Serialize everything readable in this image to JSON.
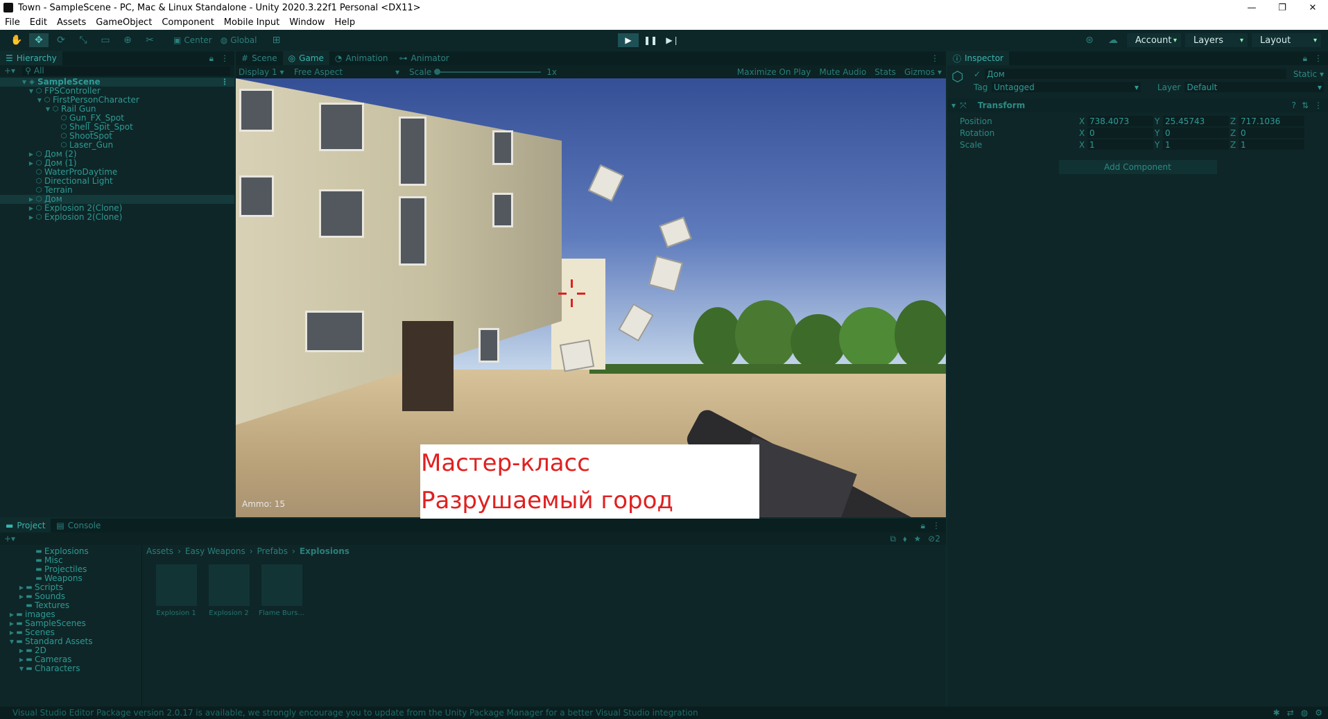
{
  "window": {
    "title": "Town - SampleScene - PC, Mac & Linux Standalone - Unity 2020.3.22f1 Personal <DX11>",
    "controls": [
      "—",
      "❐",
      "✕"
    ]
  },
  "menu": [
    "File",
    "Edit",
    "Assets",
    "GameObject",
    "Component",
    "Mobile Input",
    "Window",
    "Help"
  ],
  "toolbar": {
    "pivot": "Center",
    "space": "Global",
    "account": "Account",
    "layers": "Layers",
    "layout": "Layout"
  },
  "hierarchy": {
    "tab": "Hierarchy",
    "search": "All",
    "scene": "SampleScene",
    "items": [
      {
        "label": "FPSController",
        "depth": 1
      },
      {
        "label": "FirstPersonCharacter",
        "depth": 2
      },
      {
        "label": "Rail Gun",
        "depth": 3
      },
      {
        "label": "Gun_FX_Spot",
        "depth": 4
      },
      {
        "label": "Shell_Spit_Spot",
        "depth": 4
      },
      {
        "label": "ShootSpot",
        "depth": 4
      },
      {
        "label": "Laser_Gun",
        "depth": 4
      },
      {
        "label": "Дом (2)",
        "depth": 1
      },
      {
        "label": "Дом (1)",
        "depth": 1
      },
      {
        "label": "WaterProDaytime",
        "depth": 1
      },
      {
        "label": "Directional Light",
        "depth": 1
      },
      {
        "label": "Terrain",
        "depth": 1
      },
      {
        "label": "Дом",
        "depth": 1
      },
      {
        "label": "Explosion 2(Clone)",
        "depth": 1
      },
      {
        "label": "Explosion 2(Clone)",
        "depth": 1
      }
    ]
  },
  "center": {
    "tabs": [
      "Scene",
      "Game",
      "Animation",
      "Animator"
    ],
    "active_tab": "Game",
    "display": "Display 1",
    "aspect": "Free Aspect",
    "scale_label": "Scale",
    "scale_value": "1x",
    "options": [
      "Maximize On Play",
      "Mute Audio",
      "Stats",
      "Gizmos"
    ],
    "ammo": "Ammo: 15"
  },
  "overlay": {
    "line1": "Мастер-класс",
    "line2": "Разрушаемый город"
  },
  "inspector": {
    "tab": "Inspector",
    "object_name": "Дом",
    "static_label": "Static",
    "tag_label": "Tag",
    "tag_value": "Untagged",
    "layer_label": "Layer",
    "layer_value": "Default",
    "component": "Transform",
    "rows": [
      {
        "label": "Position",
        "x": "738.4073",
        "y": "25.45743",
        "z": "717.1036"
      },
      {
        "label": "Rotation",
        "x": "0",
        "y": "0",
        "z": "0"
      },
      {
        "label": "Scale",
        "x": "1",
        "y": "1",
        "z": "1"
      }
    ],
    "add_component": "Add Component"
  },
  "project": {
    "tabs": [
      "Project",
      "Console"
    ],
    "breadcrumb": [
      "Assets",
      "Easy Weapons",
      "Prefabs",
      "Explosions"
    ],
    "tree": [
      {
        "label": "Explosions",
        "depth": 3
      },
      {
        "label": "Misc",
        "depth": 3
      },
      {
        "label": "Projectiles",
        "depth": 3
      },
      {
        "label": "Weapons",
        "depth": 3
      },
      {
        "label": "Scripts",
        "depth": 2
      },
      {
        "label": "Sounds",
        "depth": 2
      },
      {
        "label": "Textures",
        "depth": 2
      },
      {
        "label": "images",
        "depth": 1
      },
      {
        "label": "SampleScenes",
        "depth": 1
      },
      {
        "label": "Scenes",
        "depth": 1
      },
      {
        "label": "Standard Assets",
        "depth": 1
      },
      {
        "label": "2D",
        "depth": 2
      },
      {
        "label": "Cameras",
        "depth": 2
      },
      {
        "label": "Characters",
        "depth": 2
      }
    ],
    "assets": [
      "Explosion 1",
      "Explosion 2",
      "Flame Burs..."
    ],
    "hidden_count": "2"
  },
  "status": {
    "message": "Visual Studio Editor Package version 2.0.17 is available, we strongly encourage you to update from the Unity Package Manager for a better Visual Studio integration"
  }
}
